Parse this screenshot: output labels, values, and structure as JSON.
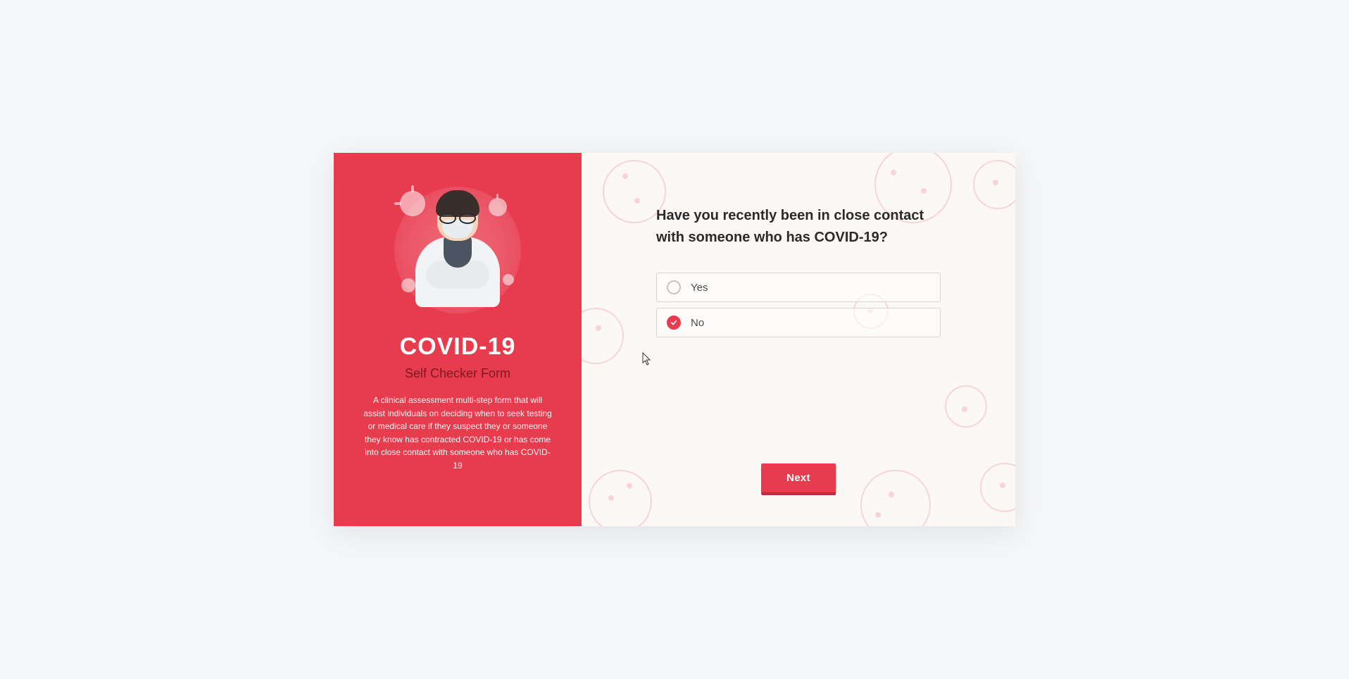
{
  "sidebar": {
    "title": "COVID-19",
    "subtitle": "Self Checker Form",
    "description": "A clinical assessment multi-step form that will assist individuals on deciding when to seek testing or medical care if they suspect they or someone they know has contracted COVID-19 or has come into close contact with someone who has COVID-19"
  },
  "form": {
    "question": "Have you recently been in close contact with someone who has COVID-19?",
    "options": [
      {
        "label": "Yes",
        "selected": false
      },
      {
        "label": "No",
        "selected": true
      }
    ],
    "next_label": "Next"
  },
  "colors": {
    "primary": "#e73c4e",
    "primary_dark": "#c4293a",
    "text": "#2a2a2a"
  }
}
